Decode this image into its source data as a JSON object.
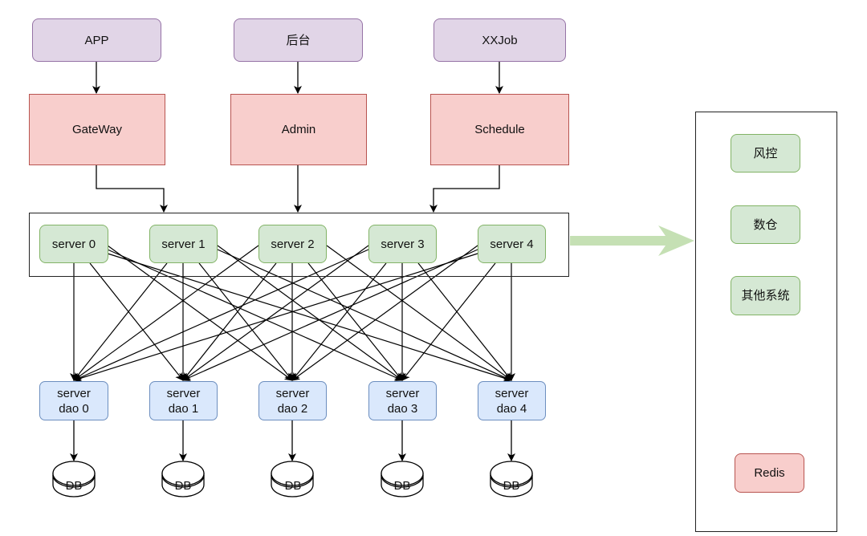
{
  "diagram": {
    "clients": [
      {
        "label": "APP"
      },
      {
        "label": "后台"
      },
      {
        "label": "XXJob"
      }
    ],
    "entries": [
      {
        "label": "GateWay"
      },
      {
        "label": "Admin"
      },
      {
        "label": "Schedule"
      }
    ],
    "servers": [
      {
        "label": "server 0"
      },
      {
        "label": "server 1"
      },
      {
        "label": "server 2"
      },
      {
        "label": "server 3"
      },
      {
        "label": "server 4"
      }
    ],
    "daos": [
      {
        "label": "server\ndao 0"
      },
      {
        "label": "server\ndao 1"
      },
      {
        "label": "server\ndao 2"
      },
      {
        "label": "server\ndao 3"
      },
      {
        "label": "server\ndao 4"
      }
    ],
    "databases": [
      {
        "label": "DB"
      },
      {
        "label": "DB"
      },
      {
        "label": "DB"
      },
      {
        "label": "DB"
      },
      {
        "label": "DB"
      }
    ],
    "external_systems": [
      {
        "label": "风控"
      },
      {
        "label": "数仓"
      },
      {
        "label": "其他系统"
      },
      {
        "label": "Redis"
      }
    ],
    "edges": {
      "client_to_entry": [
        [
          0,
          0
        ],
        [
          1,
          1
        ],
        [
          2,
          2
        ]
      ],
      "entry_to_server_group": [
        "GateWay",
        "Admin",
        "Schedule"
      ],
      "server_to_dao": "all-to-all (5 x 5)",
      "dao_to_db": [
        [
          0,
          0
        ],
        [
          1,
          1
        ],
        [
          2,
          2
        ],
        [
          3,
          3
        ],
        [
          4,
          4
        ]
      ],
      "server_group_to_external": "big green arrow"
    },
    "colors": {
      "client_fill": "#e1d5e7",
      "client_stroke": "#9673a6",
      "entry_fill": "#f8cecc",
      "entry_stroke": "#b85450",
      "server_fill": "#d5e8d4",
      "server_stroke": "#82b366",
      "dao_fill": "#dae8fc",
      "dao_stroke": "#6c8ebf",
      "big_arrow": "#c5e0b4"
    }
  }
}
